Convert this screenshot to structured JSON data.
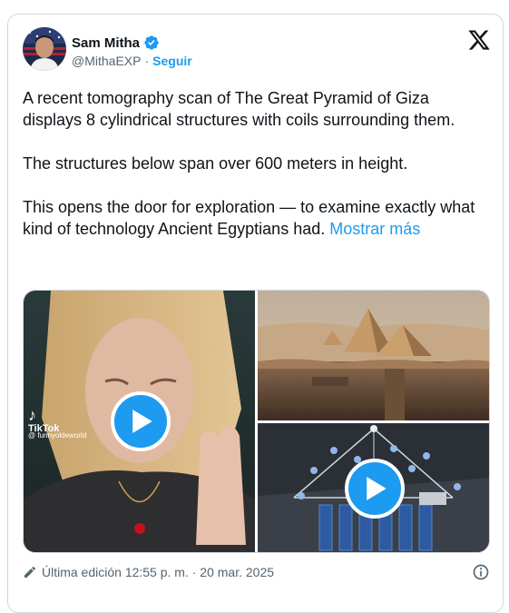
{
  "author": {
    "name": "Sam Mitha",
    "handle": "@MithaEXP",
    "separator": "·",
    "follow_label": "Seguir",
    "verified_icon": "verified-badge-icon"
  },
  "post": {
    "paragraphs": [
      "A recent tomography scan of The Great Pyramid of Giza displays 8 cylindrical structures with coils surrounding them.",
      "The structures below span over 600 meters in height.",
      "This opens the door for exploration — to examine exactly what kind of technology Ancient Egyptians had."
    ],
    "show_more": "Mostrar más"
  },
  "media": {
    "tiktok_label": "TikTok",
    "tiktok_user": "@ funnyoldeworld"
  },
  "footer": {
    "edited": "Última edición 12:55 p. m. · 20 mar. 2025"
  },
  "colors": {
    "link": "#1d9bf0",
    "secondary_text": "#536471",
    "play_button": "#1d9bf0"
  }
}
